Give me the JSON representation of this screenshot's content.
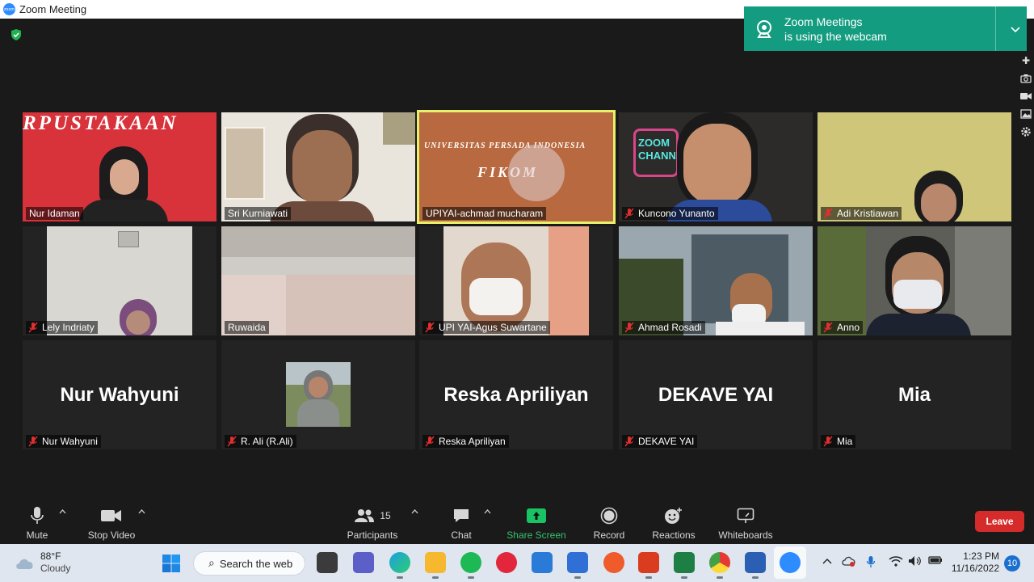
{
  "window": {
    "title": "Zoom Meeting",
    "logo_text": "zoom",
    "minimize": "—",
    "maximize": "▢",
    "close": "✕"
  },
  "notification": {
    "line1": "Zoom Meetings",
    "line2": "is using the webcam"
  },
  "tiles": [
    {
      "name": "Nur Idaman",
      "muted": false,
      "sign": "RPUSTAKAAN"
    },
    {
      "name": "Sri Kurniawati",
      "muted": false
    },
    {
      "name": "UPIYAI-achmad mucharam",
      "muted": false,
      "active": true,
      "sign1": "UNIVERSITAS PERSADA INDONESIA",
      "sign2": "FIKOM"
    },
    {
      "name": "Kuncono Yunanto",
      "muted": true,
      "sign": "ZOOM CHANNEL"
    },
    {
      "name": "Adi Kristiawan",
      "muted": true
    },
    {
      "name": "Lely Indriaty",
      "muted": true
    },
    {
      "name": "Ruwaida",
      "muted": false
    },
    {
      "name": "UPI YAI-Agus Suwartane",
      "muted": true
    },
    {
      "name": "Ahmad Rosadi",
      "muted": true
    },
    {
      "name": "Anno",
      "muted": true
    },
    {
      "name": "Nur Wahyuni",
      "muted": true,
      "display": "Nur Wahyuni"
    },
    {
      "name": "R. Ali (R.Ali)",
      "muted": true
    },
    {
      "name": "Reska Apriliyan",
      "muted": true,
      "display": "Reska Apriliyan"
    },
    {
      "name": "DEKAVE YAI",
      "muted": true,
      "display": "DEKAVE YAI"
    },
    {
      "name": "Mia",
      "muted": true,
      "display": "Mia"
    }
  ],
  "toolbar": {
    "mute": "Mute",
    "stop_video": "Stop Video",
    "participants": "Participants",
    "participants_count": "15",
    "chat": "Chat",
    "share_screen": "Share Screen",
    "record": "Record",
    "reactions": "Reactions",
    "whiteboards": "Whiteboards",
    "leave": "Leave"
  },
  "taskbar": {
    "temperature": "88°F",
    "weather": "Cloudy",
    "search": "Search the web",
    "time": "1:23 PM",
    "date": "11/16/2022",
    "notifications": "10"
  },
  "colors": {
    "accent": "#2d8cff",
    "notification": "#139c80",
    "leave": "#d62b2b",
    "active_border": "#e7f06a",
    "share": "#36c26c"
  }
}
